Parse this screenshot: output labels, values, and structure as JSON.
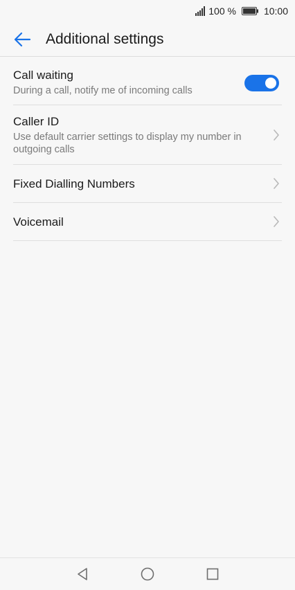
{
  "status_bar": {
    "battery_percent": "100 %",
    "time": "10:00",
    "icons": [
      "signal-icon",
      "battery-icon"
    ]
  },
  "header": {
    "title": "Additional settings",
    "back_icon": "arrow-left-icon"
  },
  "settings": {
    "call_waiting": {
      "title": "Call waiting",
      "subtitle": "During a call, notify me of incoming calls",
      "toggle_on": true
    },
    "caller_id": {
      "title": "Caller ID",
      "subtitle": "Use default carrier settings to display my number in outgoing calls"
    },
    "fixed_dialling": {
      "title": "Fixed Dialling Numbers"
    },
    "voicemail": {
      "title": "Voicemail"
    }
  },
  "nav_bar": {
    "icons": [
      "back-triangle-icon",
      "home-circle-icon",
      "recents-square-icon"
    ]
  },
  "colors": {
    "accent": "#1a73e8",
    "background": "#f7f7f7",
    "text_primary": "#1a1a1a",
    "text_secondary": "#7a7a7a",
    "divider": "#dedede",
    "chevron": "#b8b8b8",
    "nav_icon": "#6e6e6e"
  }
}
